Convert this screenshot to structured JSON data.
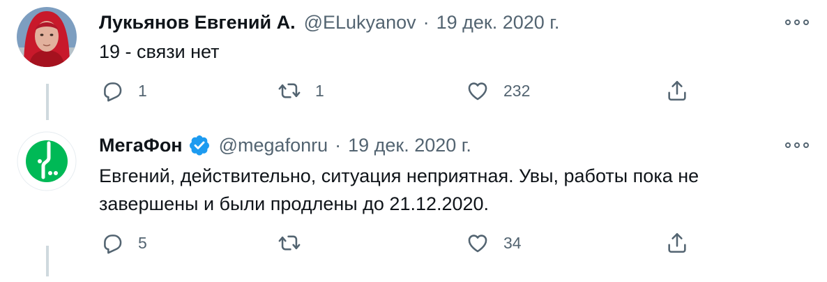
{
  "tweets": [
    {
      "name": "Лукьянов Евгений А.",
      "handle": "@ELukyanov",
      "separator": "·",
      "date": "19 дек. 2020 г.",
      "verified": false,
      "text": "19 - связи нет",
      "replies": "1",
      "retweets": "1",
      "likes": "232"
    },
    {
      "name": "МегаФон",
      "handle": "@megafonru",
      "separator": "·",
      "date": "19 дек. 2020 г.",
      "verified": true,
      "text": "Евгений, действительно, ситуация неприятная. Увы, работы пока не завершены и были продлены до 21.12.2020.",
      "replies": "5",
      "retweets": "",
      "likes": "34"
    }
  ],
  "colors": {
    "text": "#0f1419",
    "secondary": "#536471",
    "verified": "#1d9bf0",
    "megafon_green": "#00b956",
    "thread_line": "#cfd9de"
  },
  "icons": [
    "more-icon",
    "reply-icon",
    "retweet-icon",
    "like-icon",
    "share-icon",
    "verified-badge-icon"
  ]
}
